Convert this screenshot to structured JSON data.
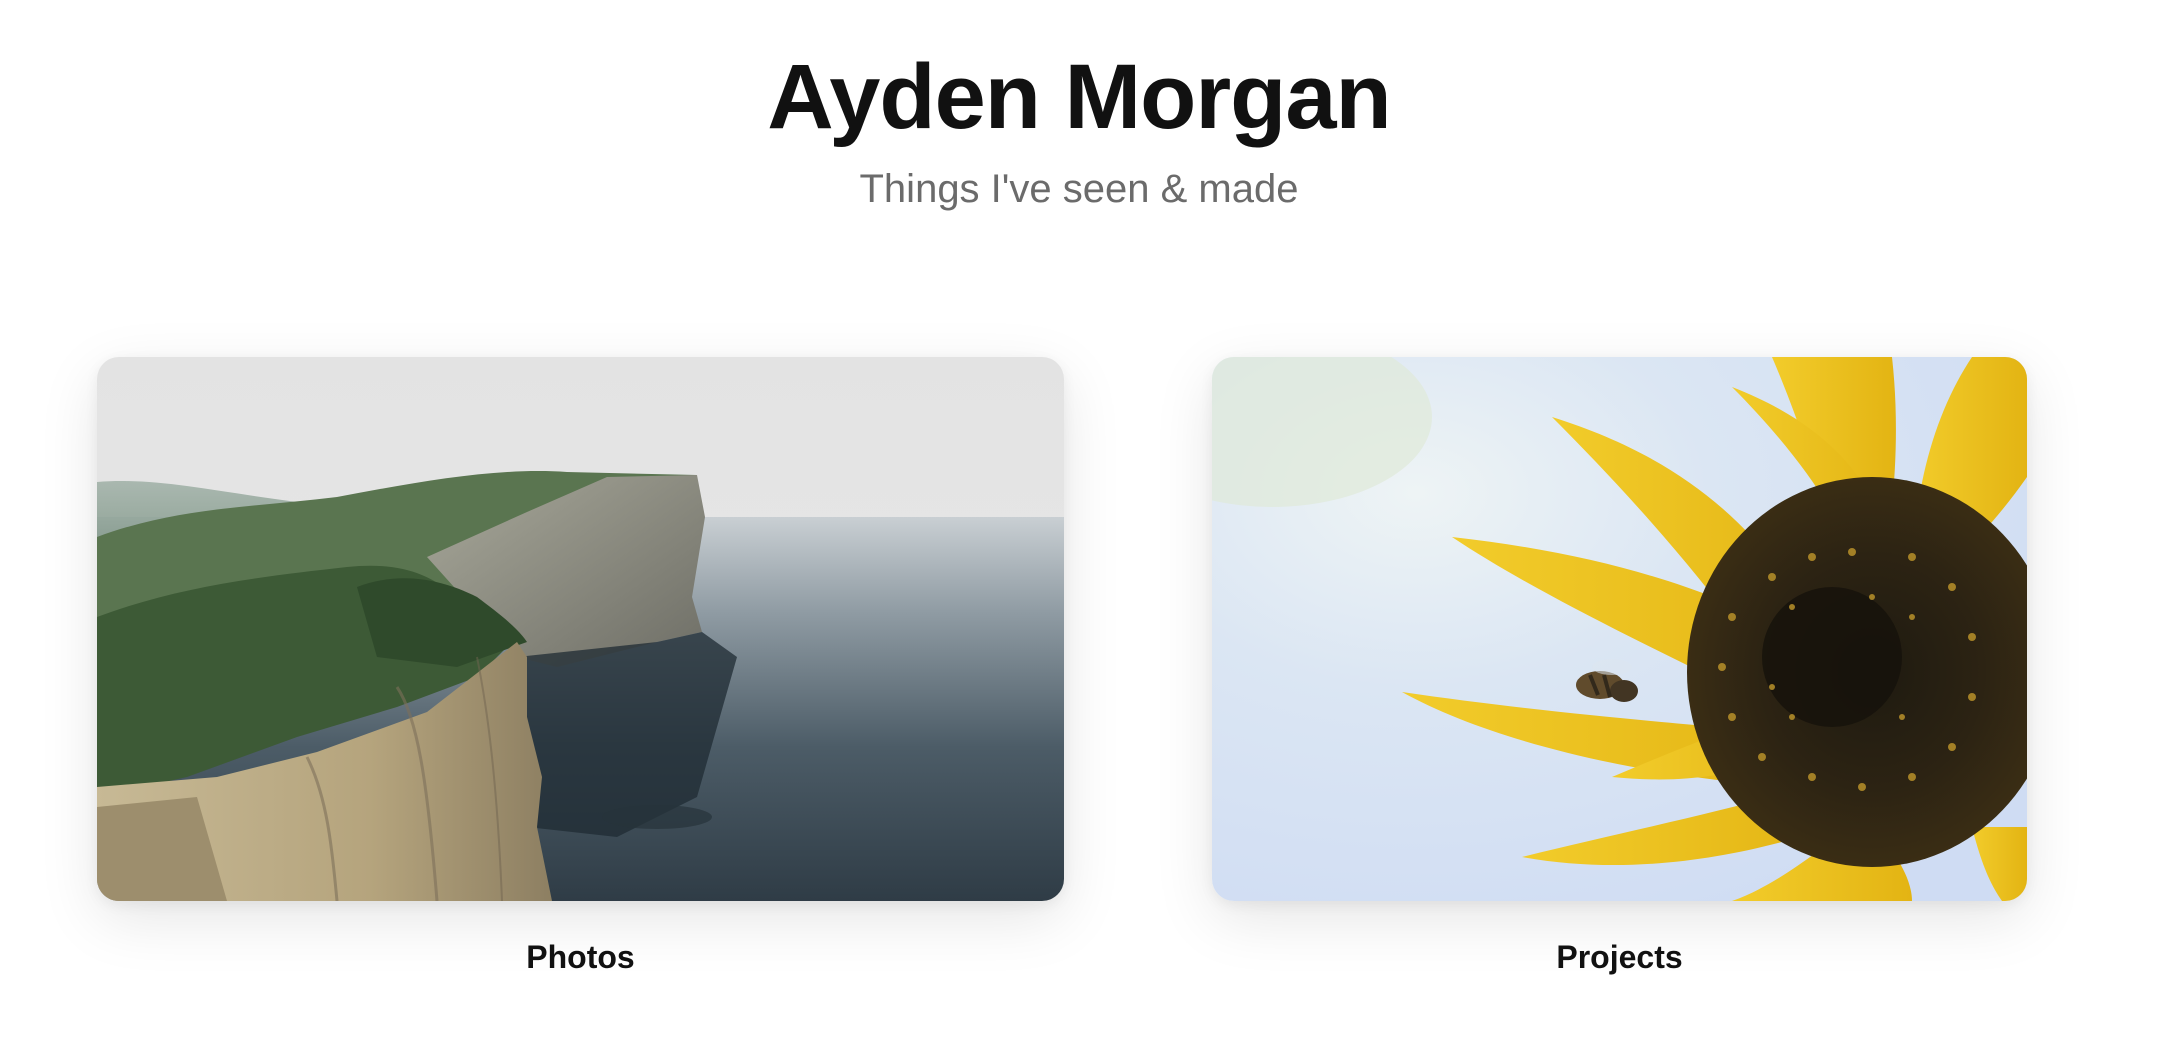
{
  "header": {
    "title": "Ayden Morgan",
    "subtitle": "Things I've seen & made"
  },
  "cards": [
    {
      "label": "Photos",
      "image": "sea-cliff-landscape-photo"
    },
    {
      "label": "Projects",
      "image": "sunflower-with-bee-photo"
    }
  ],
  "colors": {
    "title": "#111111",
    "subtitle": "#6b6b6b",
    "background": "#ffffff"
  }
}
